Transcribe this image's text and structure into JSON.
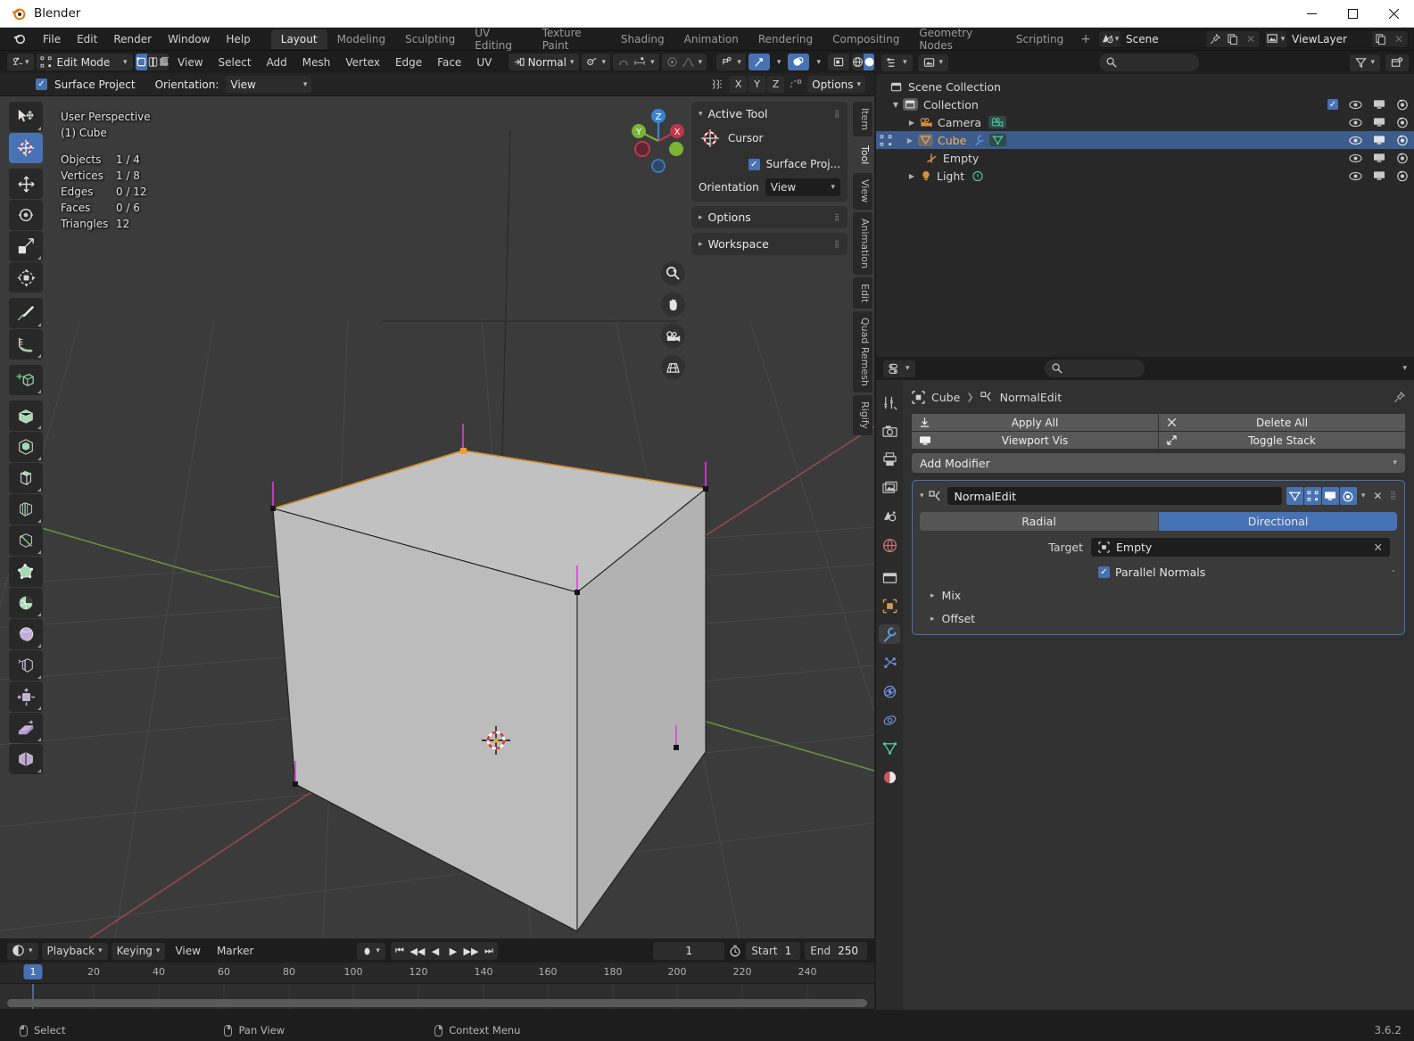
{
  "window": {
    "title": "Blender",
    "minimize": "—",
    "maximize": "☐",
    "close": "✕"
  },
  "topbar": {
    "menus": [
      "File",
      "Edit",
      "Render",
      "Window",
      "Help"
    ],
    "workspaces": [
      "Layout",
      "Modeling",
      "Sculpting",
      "UV Editing",
      "Texture Paint",
      "Shading",
      "Animation",
      "Rendering",
      "Compositing",
      "Geometry Nodes",
      "Scripting"
    ],
    "active_workspace": "Layout",
    "add_workspace": "+",
    "scene_name": "Scene",
    "viewlayer_name": "ViewLayer"
  },
  "viewport_header": {
    "mode": "Edit Mode",
    "menus": [
      "View",
      "Select",
      "Add",
      "Mesh",
      "Vertex",
      "Edge",
      "Face",
      "UV"
    ],
    "transform_orientation": "Normal",
    "options_label": "Options",
    "axis_x": "X",
    "axis_y": "Y",
    "axis_z": "Z",
    "surface_project_label": "Surface Project",
    "orientation_label": "Orientation:",
    "orientation_value": "View"
  },
  "viewport": {
    "perspective": "User Perspective",
    "active_object": "(1) Cube",
    "stats": [
      {
        "key": "Objects",
        "value": "1 / 4"
      },
      {
        "key": "Vertices",
        "value": "1 / 8"
      },
      {
        "key": "Edges",
        "value": "0 / 12"
      },
      {
        "key": "Faces",
        "value": "0 / 6"
      },
      {
        "key": "Triangles",
        "value": "12"
      }
    ],
    "gizmo_axes": [
      "Z",
      "Y",
      "X"
    ],
    "nav_buttons": [
      "zoom-icon",
      "hand-icon",
      "camera-icon",
      "grid-icon"
    ],
    "tools": [
      {
        "name": "tweak-tool",
        "active": false
      },
      {
        "name": "cursor-tool",
        "active": true
      },
      {
        "name": "move-tool",
        "active": false
      },
      {
        "name": "rotate-tool",
        "active": false
      },
      {
        "name": "scale-tool",
        "active": false
      },
      {
        "name": "transform-tool",
        "active": false
      },
      {
        "name": "annotate-tool",
        "active": false
      },
      {
        "name": "measure-tool",
        "active": false
      },
      {
        "name": "add-cube-tool",
        "active": false
      },
      {
        "name": "extrude-region-tool",
        "active": false
      },
      {
        "name": "inset-faces-tool",
        "active": false
      },
      {
        "name": "bevel-tool",
        "active": false
      },
      {
        "name": "loop-cut-tool",
        "active": false
      },
      {
        "name": "knife-tool",
        "active": false
      },
      {
        "name": "poly-build-tool",
        "active": false
      },
      {
        "name": "spin-tool",
        "active": false
      },
      {
        "name": "smooth-tool",
        "active": false
      },
      {
        "name": "edge-slide-tool",
        "active": false
      },
      {
        "name": "shrink-fatten-tool",
        "active": false
      },
      {
        "name": "shear-tool",
        "active": false
      },
      {
        "name": "rip-region-tool",
        "active": false
      }
    ]
  },
  "npanel": {
    "active_tool_title": "Active Tool",
    "tool_name": "Cursor",
    "surface_project": "Surface Proj...",
    "orientation_label": "Orientation",
    "orientation_value": "View",
    "options_title": "Options",
    "workspace_title": "Workspace",
    "tabs": [
      "Item",
      "Tool",
      "View",
      "Animation",
      "Edit",
      "Quad Remesh",
      "Rigify"
    ],
    "active_tab": "Tool"
  },
  "timeline": {
    "playback": "Playback",
    "keying": "Keying",
    "view": "View",
    "marker": "Marker",
    "current_frame": "1",
    "start_label": "Start",
    "start_value": "1",
    "end_label": "End",
    "end_value": "250",
    "ticks": [
      "20",
      "40",
      "60",
      "80",
      "100",
      "120",
      "140",
      "160",
      "180",
      "200",
      "220",
      "240"
    ],
    "playhead_label": "1"
  },
  "outliner": {
    "root": "Scene Collection",
    "items": [
      {
        "label": "Collection",
        "indent": 1,
        "icon": "collection-icon",
        "expand": "▼",
        "selected": false,
        "checkbox": true,
        "badges": []
      },
      {
        "label": "Camera",
        "indent": 2,
        "icon": "camera-object-icon",
        "expand": "▶",
        "selected": false,
        "checkbox": false,
        "badges": [
          "camera-data-icon"
        ]
      },
      {
        "label": "Cube",
        "indent": 2,
        "icon": "mesh-object-icon",
        "expand": "▶",
        "selected": true,
        "checkbox": false,
        "badges": [
          "modifier-icon",
          "mesh-data-icon"
        ]
      },
      {
        "label": "Empty",
        "indent": 3,
        "icon": "empty-axis-icon",
        "expand": "",
        "selected": false,
        "checkbox": false,
        "badges": []
      },
      {
        "label": "Light",
        "indent": 2,
        "icon": "light-object-icon",
        "expand": "▶",
        "selected": false,
        "checkbox": false,
        "badges": [
          "light-data-icon"
        ]
      }
    ]
  },
  "properties": {
    "breadcrumb_object": "Cube",
    "breadcrumb_modifier": "NormalEdit",
    "apply_all": "Apply All",
    "delete_all": "Delete All",
    "viewport_vis": "Viewport Vis",
    "toggle_stack": "Toggle Stack",
    "add_modifier": "Add Modifier",
    "modifier_name": "NormalEdit",
    "mode_radial": "Radial",
    "mode_directional": "Directional",
    "active_mode": "Directional",
    "target_label": "Target",
    "target_value": "Empty",
    "parallel_normals": "Parallel Normals",
    "mix_section": "Mix",
    "offset_section": "Offset",
    "tabs": [
      "tool-tab",
      "render-tab",
      "output-tab",
      "viewlayer-tab",
      "scene-tab",
      "world-tab",
      "collection-tab",
      "object-tab",
      "modifier-tab",
      "particles-tab",
      "physics-tab",
      "constraints-tab",
      "data-tab",
      "material-tab"
    ],
    "active_tab": "modifier-tab"
  },
  "statusbar": {
    "select": "Select",
    "pan_view": "Pan View",
    "context_menu": "Context Menu",
    "version": "3.6.2"
  },
  "colors": {
    "accent_blue": "#4772b3",
    "selected_orange": "#ffaf50",
    "panel_bg": "#303030",
    "viewport_bg": "#3b3b3b"
  }
}
